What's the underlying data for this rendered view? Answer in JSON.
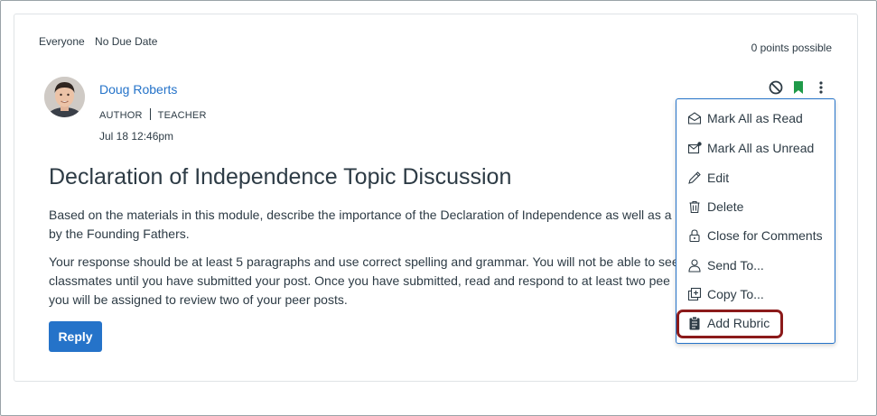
{
  "header": {
    "audience": "Everyone",
    "due": "No Due Date",
    "points": "0 points possible"
  },
  "author": {
    "name": "Doug Roberts",
    "role1": "AUTHOR",
    "role2": "TEACHER",
    "date": "Jul 18 12:46pm"
  },
  "topic": {
    "title": "Declaration of Independence Topic Discussion",
    "para1_line1": "Based on the materials in this module, describe the importance of the Declaration of Independence as well as a",
    "para1_line2": "by the Founding Fathers.",
    "para2_line1": "Your response should be at least 5 paragraphs and use correct spelling and grammar. You will not be able to see",
    "para2_line2": "classmates until you have submitted your post. Once you have submitted, read and respond to at least two pee",
    "para2_line3": "you will be assigned to review two of your peer posts."
  },
  "reply_label": "Reply",
  "icons": {
    "unpublish": "no-entry-icon",
    "bookmark": "bookmark-icon",
    "more": "kebab-menu-icon"
  },
  "menu": {
    "items": [
      {
        "label": "Mark All as Read",
        "icon": "envelope-open-icon"
      },
      {
        "label": "Mark All as Unread",
        "icon": "envelope-unread-icon"
      },
      {
        "label": "Edit",
        "icon": "pencil-icon"
      },
      {
        "label": "Delete",
        "icon": "trash-icon"
      },
      {
        "label": "Close for Comments",
        "icon": "lock-icon"
      },
      {
        "label": "Send To...",
        "icon": "user-icon"
      },
      {
        "label": "Copy To...",
        "icon": "copy-icon"
      },
      {
        "label": "Add Rubric",
        "icon": "rubric-icon"
      }
    ]
  },
  "colors": {
    "link": "#2573c9",
    "button": "#2573c9",
    "bookmark": "#1f9a49",
    "highlight": "#8b1a1a",
    "text": "#2d3b45"
  }
}
